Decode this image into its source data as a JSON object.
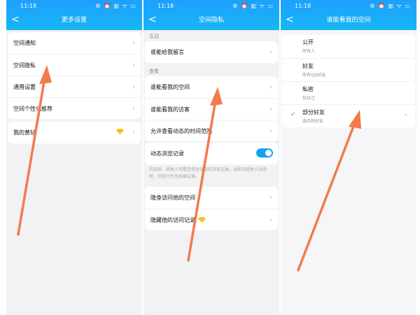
{
  "status": {
    "time": "11:18",
    "icons": "⚙ ⏰ ▥ ᯤ ▭"
  },
  "colors": {
    "header_start": "#1ea0ff",
    "header_end": "#17b6f4",
    "toggle_on": "#12a2f7",
    "arrow": "#f47a4e",
    "gem": "#f5c228"
  },
  "panel1": {
    "title": "更多设置",
    "group1": [
      "空间通知",
      "空间隐私",
      "通用设置",
      "空间个性化推荐"
    ],
    "group2": {
      "label": "我的黄钻"
    }
  },
  "panel2": {
    "title": "空间隐私",
    "section_interact": "互动",
    "who_can_comment": "谁能给我留言",
    "section_view": "查看",
    "view_items": [
      "谁能看我的空间",
      "谁能看我的访客",
      "允许查看动态的时间范围"
    ],
    "browse_record": {
      "label": "动态浏览记录",
      "enabled": true
    },
    "hint": "开启后，其他人可看见你对动态的浏览记录。当你浏览他人动态时，浏览行为也会被记录。",
    "visit_items": [
      "隐身访问他的空间",
      "隐藏他的访问记录"
    ]
  },
  "panel3": {
    "title": "谁能看我的空间",
    "options": [
      {
        "main": "公开",
        "sub": "所有人",
        "checked": false
      },
      {
        "main": "好友",
        "sub": "所有QQ好友",
        "checked": false
      },
      {
        "main": "私密",
        "sub": "仅自己",
        "checked": false
      },
      {
        "main": "部分好友",
        "sub": "选中的好友",
        "checked": true
      }
    ]
  },
  "icons": {
    "back": "chevron-left-icon",
    "chevron": "chevron-right-icon",
    "check": "check-icon",
    "expand": "chevron-down-icon",
    "gem": "diamond-icon"
  }
}
